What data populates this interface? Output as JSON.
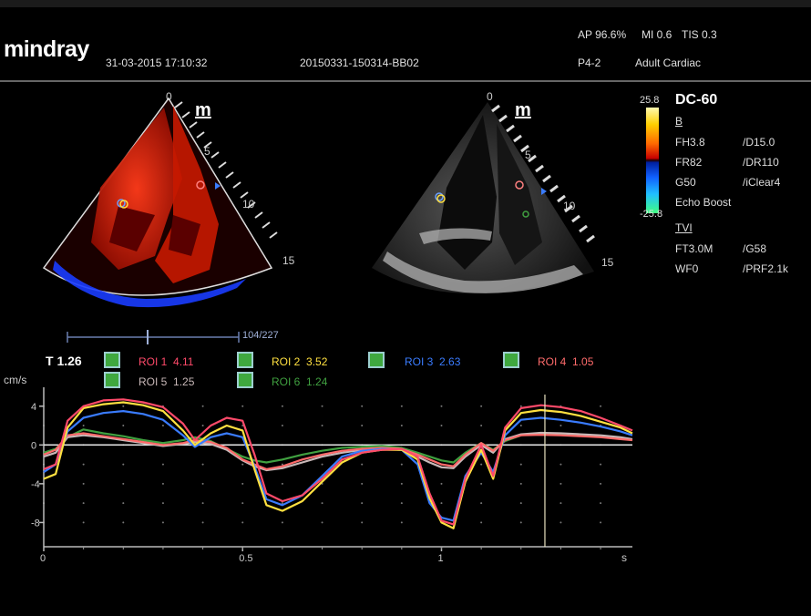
{
  "header": {
    "brand": "mindray",
    "datetime": "31-03-2015 17:10:32",
    "exam_id": "20150331-150314-BB02",
    "power": "AP 96.6%",
    "mi": "MI 0.6",
    "tis": "TIS 0.3",
    "probe": "P4-2",
    "preset": "Adult Cardiac"
  },
  "images": {
    "left_marker": "m",
    "right_marker": "m",
    "depth_ticks": [
      "0",
      "5",
      "10",
      "15"
    ]
  },
  "params": {
    "title": "DC-60",
    "bmode_label": "B",
    "rows": [
      [
        "FH3.8",
        "/D15.0"
      ],
      [
        "FR82",
        "/DR110"
      ],
      [
        "G50",
        "/iClear4"
      ]
    ],
    "echo_boost": "Echo Boost",
    "tvi_label": "TVI",
    "tvi_rows": [
      [
        "FT3.0M",
        "/G58"
      ],
      [
        "WF0",
        "/PRF2.1k"
      ]
    ],
    "scale_max": "25.8",
    "scale_min": "-25.8"
  },
  "cine": {
    "frame": "104/227"
  },
  "roi_panel": {
    "time_label": "T 1.26",
    "rois": [
      {
        "label": "ROI 1",
        "value": "4.11",
        "color": "#ff4a6a"
      },
      {
        "label": "ROI 2",
        "value": "3.52",
        "color": "#ffe040"
      },
      {
        "label": "ROI 3",
        "value": "2.63",
        "color": "#3a7cff"
      },
      {
        "label": "ROI 4",
        "value": "1.05",
        "color": "#ff6b6b"
      },
      {
        "label": "ROI 5",
        "value": "1.25",
        "color": "#c8b8b8"
      },
      {
        "label": "ROI 6",
        "value": "1.24",
        "color": "#40a040"
      }
    ]
  },
  "chart_data": {
    "type": "line",
    "ylabel": "cm/s",
    "xlabel": "s",
    "xlim": [
      0,
      1.48
    ],
    "ylim": [
      -10.5,
      5.2
    ],
    "x_ticks": [
      0,
      0.5,
      1
    ],
    "y_ticks": [
      4,
      0,
      -4,
      -8
    ],
    "cursor_x": 1.26,
    "x": [
      0,
      0.03,
      0.06,
      0.1,
      0.15,
      0.2,
      0.25,
      0.3,
      0.35,
      0.38,
      0.42,
      0.46,
      0.5,
      0.53,
      0.56,
      0.6,
      0.65,
      0.7,
      0.75,
      0.8,
      0.85,
      0.9,
      0.94,
      0.97,
      1.0,
      1.03,
      1.06,
      1.1,
      1.13,
      1.16,
      1.2,
      1.25,
      1.3,
      1.35,
      1.4,
      1.45,
      1.48
    ],
    "series": [
      {
        "name": "ROI 1",
        "color": "#ff4a6a",
        "values": [
          -2.5,
          -2,
          2.5,
          4.0,
          4.6,
          4.7,
          4.4,
          3.9,
          2.2,
          0.5,
          2.0,
          2.8,
          2.5,
          -1.0,
          -5.0,
          -5.8,
          -5.2,
          -3.5,
          -1.5,
          -0.8,
          -0.5,
          -0.4,
          -1.2,
          -5.0,
          -7.8,
          -8.2,
          -3.5,
          0.0,
          -3.2,
          1.8,
          3.8,
          4.1,
          3.9,
          3.5,
          2.8,
          2.0,
          1.5
        ]
      },
      {
        "name": "ROI 2",
        "color": "#ffe040",
        "values": [
          -3.5,
          -3.0,
          1.8,
          3.8,
          4.2,
          4.4,
          4.1,
          3.5,
          1.5,
          0.0,
          1.2,
          2.0,
          1.5,
          -2.5,
          -6.2,
          -6.8,
          -5.8,
          -3.8,
          -1.8,
          -0.8,
          -0.5,
          -0.5,
          -1.5,
          -5.5,
          -8.0,
          -8.6,
          -3.8,
          -0.5,
          -3.5,
          1.5,
          3.3,
          3.6,
          3.4,
          3.0,
          2.4,
          1.8,
          1.2
        ]
      },
      {
        "name": "ROI 3",
        "color": "#3a7cff",
        "values": [
          -2.8,
          -2.0,
          1.4,
          2.8,
          3.3,
          3.5,
          3.2,
          2.6,
          1.0,
          -0.2,
          0.8,
          1.2,
          0.8,
          -2.2,
          -5.6,
          -6.2,
          -5.2,
          -3.2,
          -1.2,
          -0.6,
          -0.4,
          -0.5,
          -2.0,
          -6.0,
          -7.5,
          -7.8,
          -3.2,
          -0.8,
          -2.8,
          1.0,
          2.6,
          2.8,
          2.6,
          2.3,
          1.9,
          1.4,
          1.0
        ]
      },
      {
        "name": "ROI 4",
        "color": "#ff6b6b",
        "values": [
          -1.0,
          -0.5,
          1.0,
          1.2,
          0.9,
          0.6,
          0.3,
          0.0,
          0.2,
          0.5,
          0.3,
          -0.3,
          -1.5,
          -2.0,
          -2.5,
          -2.2,
          -1.5,
          -1.0,
          -0.6,
          -0.4,
          -0.3,
          -0.4,
          -1.0,
          -1.5,
          -2.0,
          -2.2,
          -1.0,
          0.2,
          -0.6,
          0.5,
          1.0,
          1.05,
          1.0,
          0.9,
          0.8,
          0.6,
          0.5
        ]
      },
      {
        "name": "ROI 5",
        "color": "#c8b8b8",
        "values": [
          -1.2,
          -0.8,
          0.8,
          1.0,
          0.8,
          0.5,
          0.2,
          -0.1,
          0.1,
          0.3,
          0.1,
          -0.5,
          -1.6,
          -2.2,
          -2.6,
          -2.4,
          -1.8,
          -1.2,
          -0.8,
          -0.5,
          -0.4,
          -0.5,
          -1.2,
          -1.8,
          -2.3,
          -2.4,
          -1.2,
          0.0,
          -0.8,
          0.6,
          1.1,
          1.25,
          1.2,
          1.1,
          1.0,
          0.8,
          0.6
        ]
      },
      {
        "name": "ROI 6",
        "color": "#40a040",
        "values": [
          -0.8,
          -0.4,
          0.8,
          1.6,
          1.2,
          0.9,
          0.5,
          0.2,
          0.5,
          0.8,
          0.4,
          -0.4,
          -1.2,
          -1.6,
          -1.8,
          -1.5,
          -1.0,
          -0.6,
          -0.3,
          -0.2,
          -0.1,
          -0.3,
          -0.8,
          -1.2,
          -1.6,
          -1.8,
          -0.8,
          0.2,
          -0.5,
          0.4,
          1.0,
          1.24,
          1.1,
          1.0,
          0.9,
          0.7,
          0.5
        ]
      }
    ]
  }
}
